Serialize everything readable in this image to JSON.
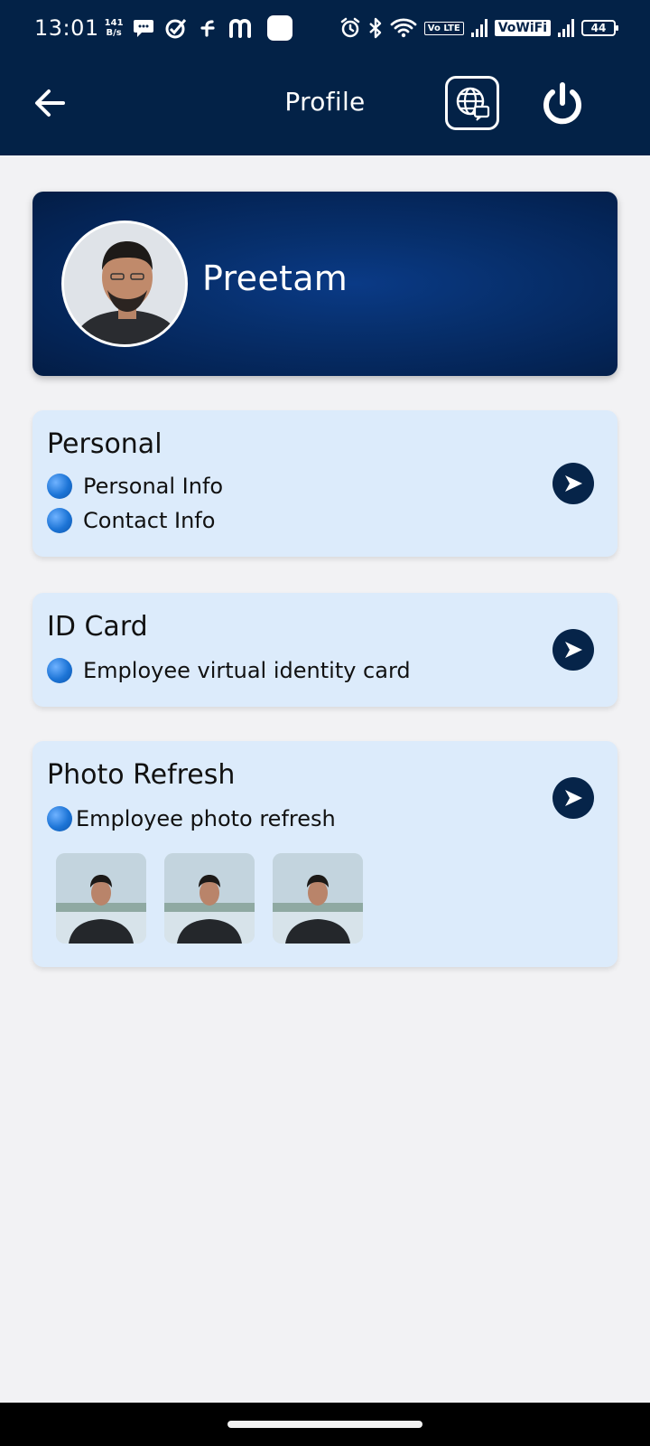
{
  "status_bar": {
    "time": "13:01",
    "net_speed_value": "141",
    "net_speed_unit": "B/s",
    "volte": "Vo LTE",
    "vowifi": "VoWiFi",
    "battery": "44"
  },
  "app_bar": {
    "title": "Profile",
    "back_icon": "arrow-left-icon",
    "language_icon": "globe-translate-icon",
    "power_icon": "power-icon"
  },
  "profile": {
    "name": "Preetam"
  },
  "sections": {
    "personal": {
      "title": "Personal",
      "items": [
        "Personal Info",
        "Contact Info"
      ]
    },
    "id_card": {
      "title": "ID Card",
      "items": [
        "Employee virtual identity card"
      ]
    },
    "photo_refresh": {
      "title": "Photo Refresh",
      "items": [
        "Employee photo refresh"
      ]
    }
  },
  "colors": {
    "header_bg": "#032247",
    "card_bg": "#dcebfb",
    "accent_button": "#062449",
    "page_bg": "#f2f2f4"
  }
}
